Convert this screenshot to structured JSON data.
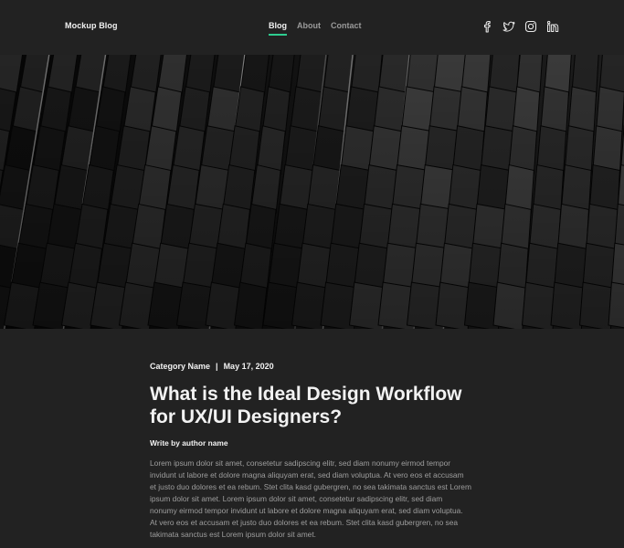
{
  "header": {
    "brand": "Mockup Blog",
    "nav": [
      {
        "label": "Blog",
        "active": true
      },
      {
        "label": "About",
        "active": false
      },
      {
        "label": "Contact",
        "active": false
      }
    ],
    "social_icons": [
      "facebook-icon",
      "twitter-icon",
      "instagram-icon",
      "linkedin-icon"
    ]
  },
  "hero": {
    "image": "dark-building-facade"
  },
  "article": {
    "category": "Category Name",
    "separator": "|",
    "date": "May 17, 2020",
    "title": "What is the Ideal Design Workflow for UX/UI Designers?",
    "author": "Write by author name",
    "body": "Lorem ipsum dolor sit amet, consetetur sadipscing elitr, sed diam nonumy eirmod tempor invidunt ut labore et dolore magna aliquyam erat, sed diam voluptua. At vero eos et accusam et justo duo dolores et ea rebum. Stet clita kasd gubergren, no sea takimata sanctus est Lorem ipsum dolor sit amet. Lorem ipsum dolor sit amet, consetetur sadipscing elitr, sed diam nonumy eirmod tempor invidunt ut labore et dolore magna aliquyam erat, sed diam voluptua. At vero eos et accusam et justo duo dolores et ea rebum. Stet clita kasd gubergren, no sea takimata sanctus est Lorem ipsum dolor sit amet."
  },
  "colors": {
    "background": "#222222",
    "accent": "#2ecc8f",
    "text_primary": "#f2f2f2",
    "text_muted": "#9e9e9e"
  }
}
